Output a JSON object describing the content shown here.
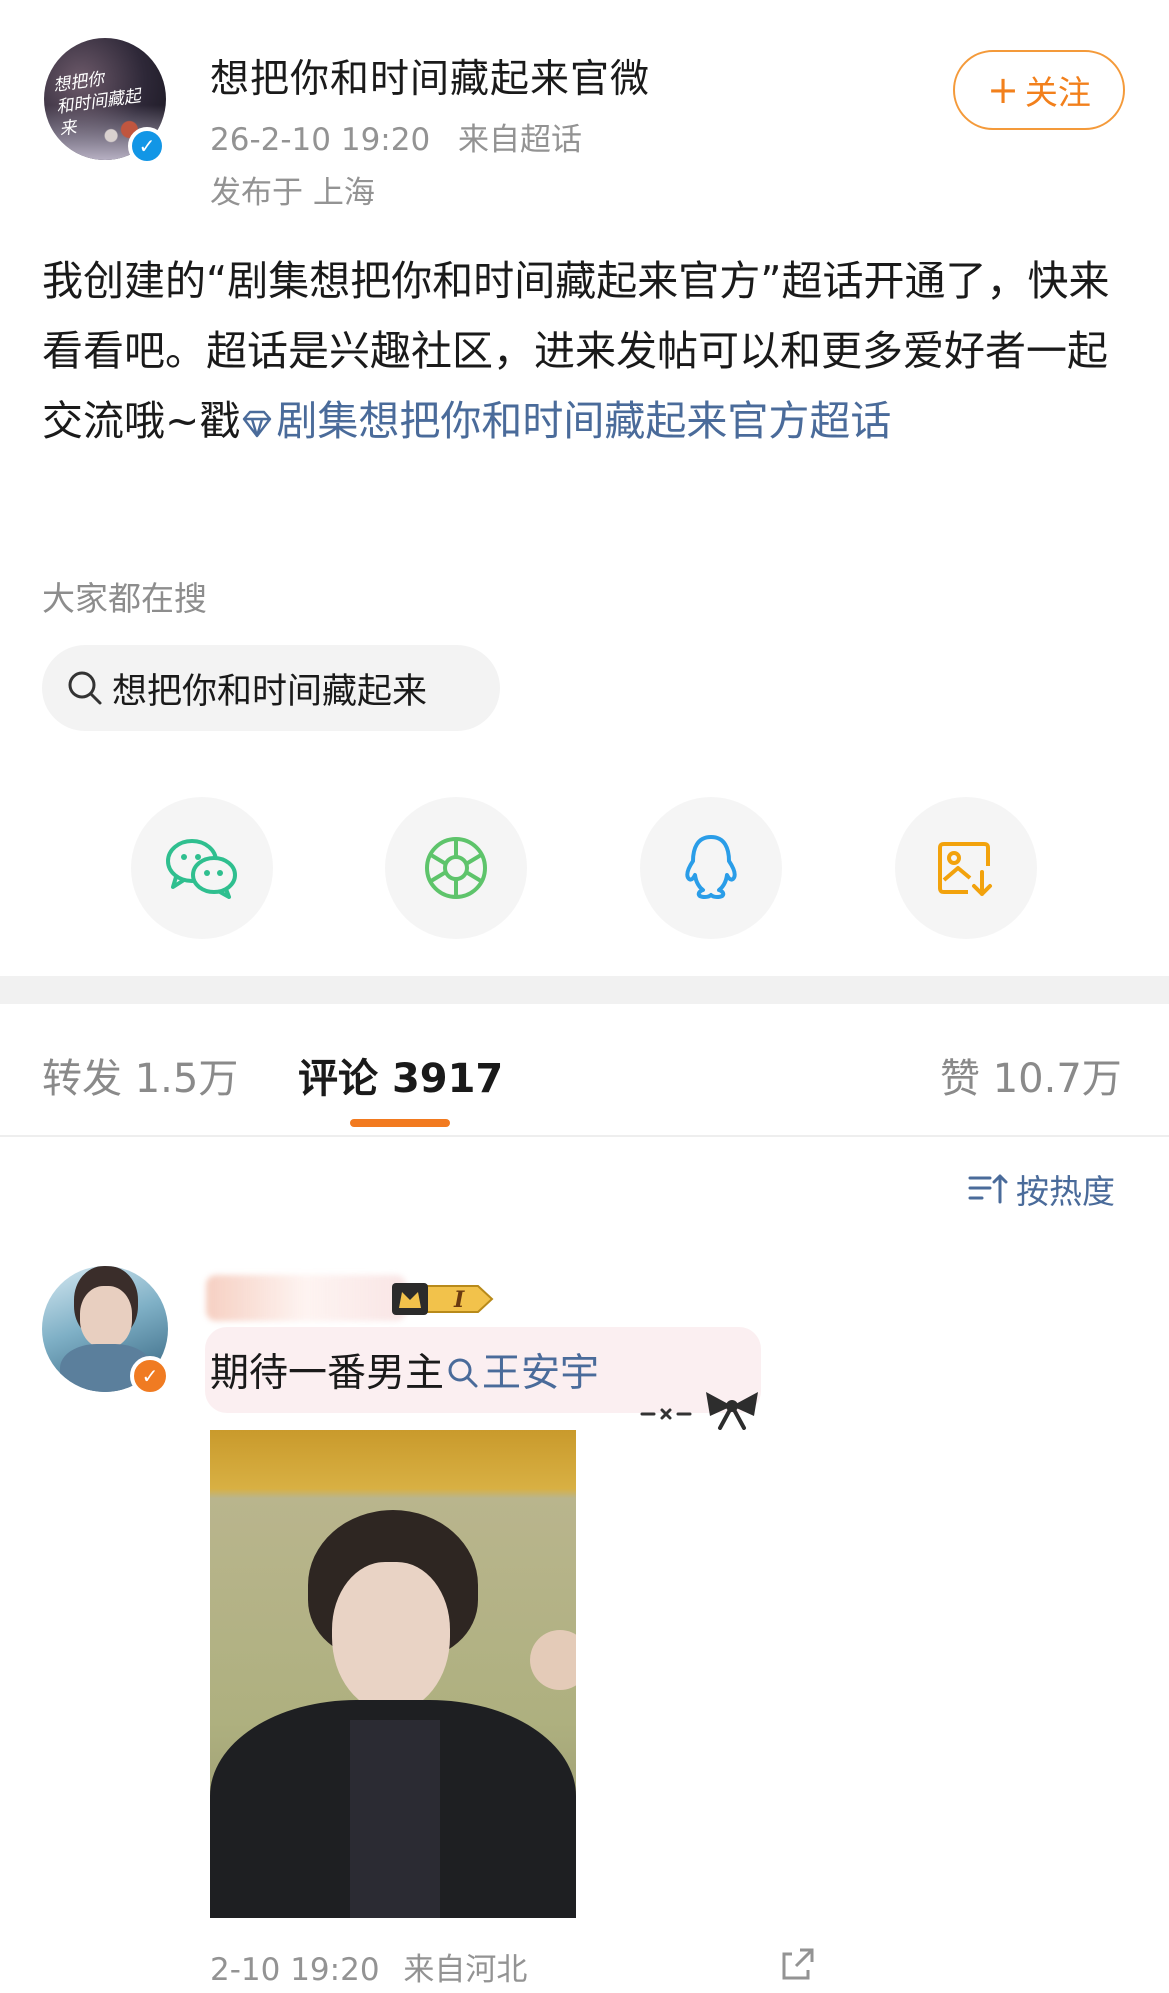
{
  "post": {
    "author_name": "想把你和时间藏起来官微",
    "avatar_text_line1": "想把你",
    "avatar_text_line2": "和时间藏起来",
    "time": "26-2-10 19:20",
    "source": "来自超话",
    "location": "发布于 上海",
    "follow_label": "关注",
    "text_part1": "我创建的“剧集想把你和时间藏起来官方”超话开通了，快来看看吧。超话是兴趣社区，进来发帖可以和更多爱好者一起交流哦~戳",
    "topic_link": "剧集想把你和时间藏起来官方超话"
  },
  "hot_search": {
    "label": "大家都在搜",
    "query": "想把你和时间藏起来"
  },
  "share": {
    "icons": [
      "wechat-icon",
      "moments-icon",
      "qq-icon",
      "save-image-icon"
    ],
    "colors": {
      "wechat": "#2fbf8f",
      "moments": "#5ec46b",
      "qq": "#2a9de8",
      "save": "#f2a20c"
    }
  },
  "tabs": {
    "repost_label": "转发",
    "repost_count": "1.5万",
    "comment_label": "评论",
    "comment_count": "3917",
    "like_label": "赞",
    "like_count": "10.7万"
  },
  "sort": {
    "label": "按热度"
  },
  "comment": {
    "rank_badge": "I",
    "text": "期待一番男主",
    "topic": "王安宇",
    "time": "2-10 19:20",
    "source": "来自河北"
  },
  "colors": {
    "accent_orange": "#f27a1f",
    "link_blue": "#4a6b9a",
    "muted_gray": "#939393"
  }
}
